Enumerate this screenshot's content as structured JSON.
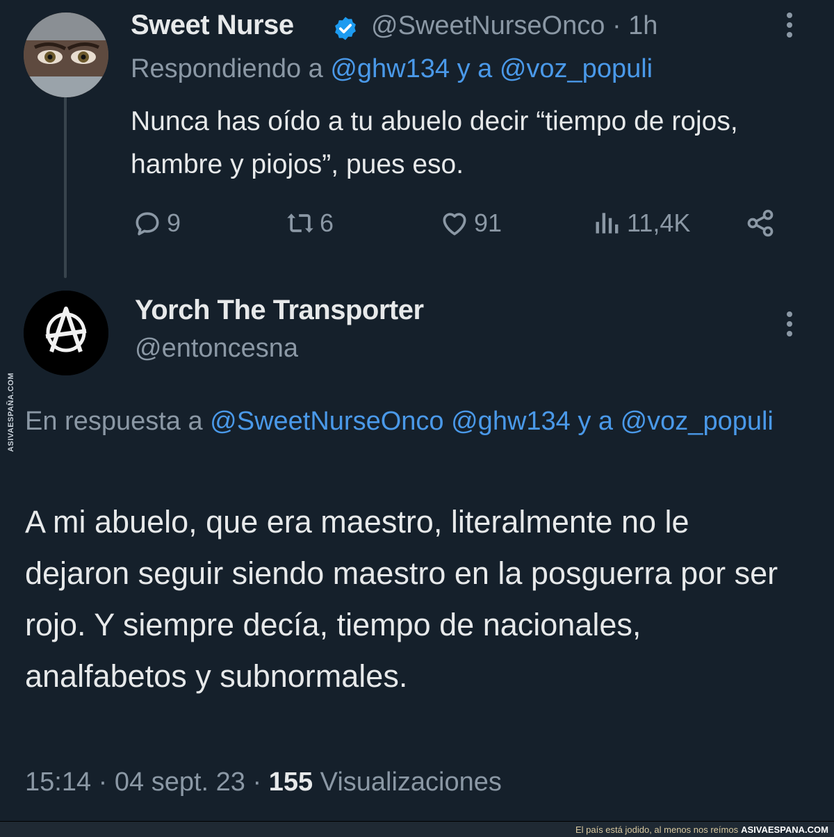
{
  "tweet1": {
    "name": "Sweet Nurse",
    "handle": "@SweetNurseOnco",
    "time": "· 1h",
    "replying_prefix": "Respondiendo a ",
    "replying_user1": "@ghw134",
    "replying_mid": " y a ",
    "replying_user2": "@voz_populi",
    "text": "Nunca has oído a tu abuelo decir “tiempo de rojos, hambre y piojos”, pues eso.",
    "replies": "9",
    "retweets": "6",
    "likes": "91",
    "views": "11,4K"
  },
  "tweet2": {
    "name": "Yorch The Transporter",
    "handle": "@entoncesna",
    "replying_prefix": "En respuesta a ",
    "replying_users": "@SweetNurseOnco @ghw134 y a @voz_populi",
    "text": "A mi abuelo, que era maestro, literalmente no le dejaron seguir siendo maestro en la posguerra por ser rojo. Y siempre decía, tiempo de nacionales, analfabetos y subnormales.",
    "time": "15:14",
    "date": "04 sept. 23",
    "views_count": "155",
    "views_label": "Visualizaciones"
  },
  "watermark": {
    "side": "ASIVAESPAÑA.COM",
    "tagline": "El país está jodido, al menos nos reímos",
    "site": "ASIVAESPANA.COM"
  },
  "colors": {
    "background": "#15202b",
    "link": "#4a99e9",
    "muted": "#8b98a5",
    "verified": "#1d9bf0"
  }
}
